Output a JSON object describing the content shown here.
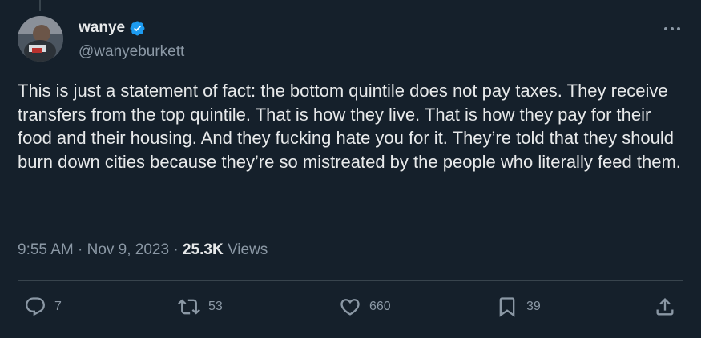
{
  "author": {
    "display_name": "wanye",
    "handle": "@wanyeburkett",
    "verified": true
  },
  "tweet": {
    "text": "This is just a statement of fact: the bottom quintile does not pay taxes. They receive transfers from the top quintile. That is how they live. That is how they pay for their food and their housing. And they fucking hate you for it. They’re told that they should burn down cities because they’re so mistreated by the people who literally feed them.",
    "time": "9:55 AM",
    "date": "Nov 9, 2023",
    "separator": "·",
    "views_count": "25.3K",
    "views_label": "Views"
  },
  "actions": {
    "replies": "7",
    "reposts": "53",
    "likes": "660",
    "bookmarks": "39"
  },
  "icons": {
    "verified": "verified-badge-icon",
    "more": "more-dots-icon",
    "reply": "reply-bubble-icon",
    "repost": "repost-arrows-icon",
    "like": "heart-icon",
    "bookmark": "bookmark-icon",
    "share": "share-upload-icon"
  },
  "colors": {
    "background": "#15202b",
    "text": "#e7e9ea",
    "secondary": "#8b98a5",
    "accent": "#1d9bf0",
    "divider": "#38444d"
  }
}
